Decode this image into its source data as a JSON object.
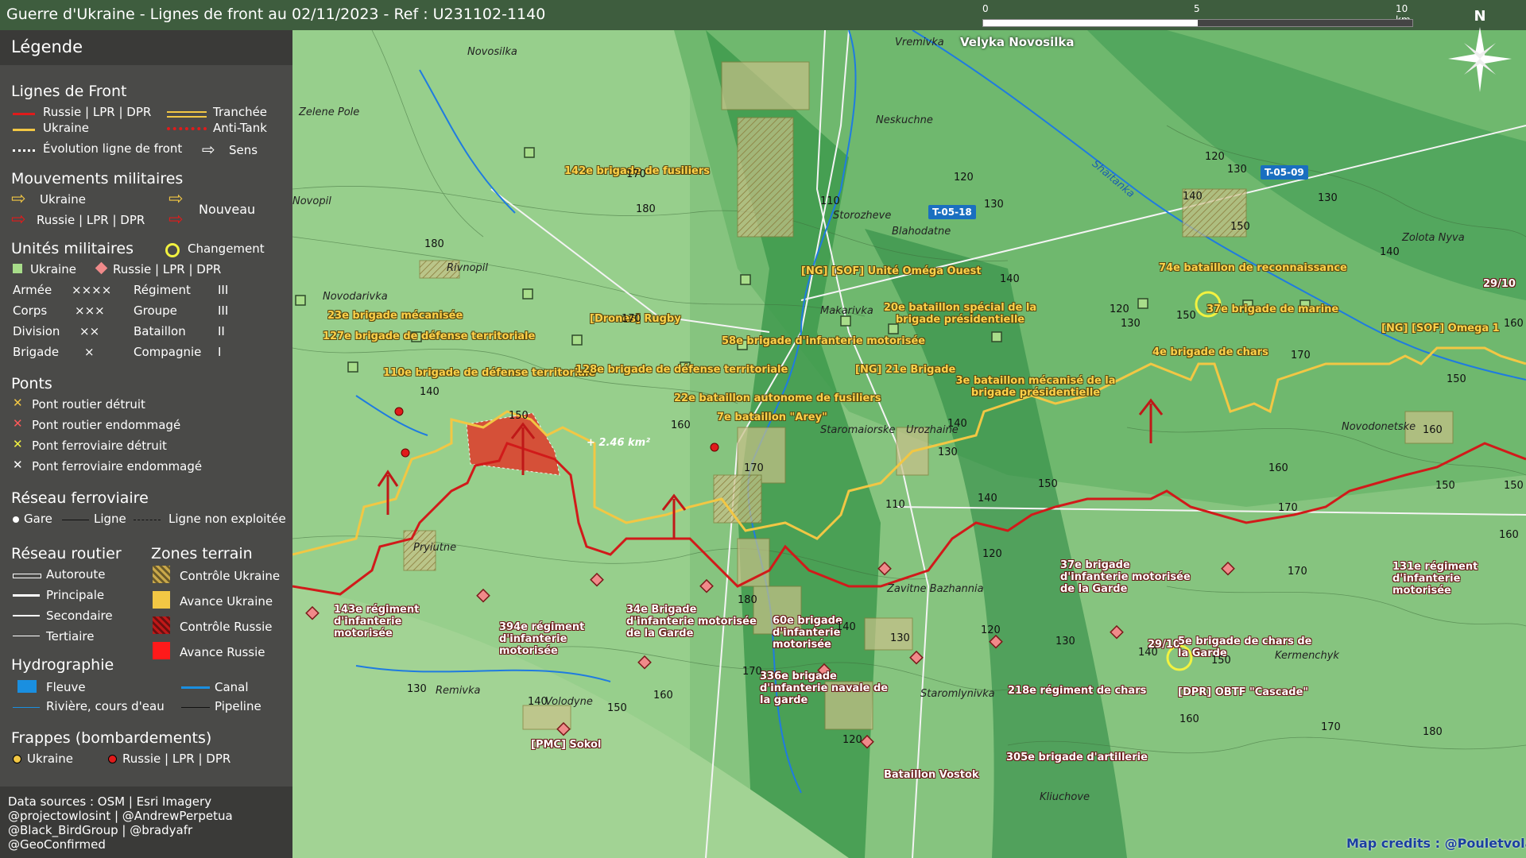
{
  "title": "Guerre d'Ukraine - Lignes de front au 02/11/2023 - Ref : U231102-1140",
  "scale": {
    "l0": "0",
    "l5": "5",
    "l10": "10 km"
  },
  "north": "N",
  "legend": {
    "header": "Légende",
    "front_title": "Lignes de Front",
    "front_ru": "Russie | LPR | DPR",
    "front_ua": "Ukraine",
    "front_evo": "Évolution ligne de front",
    "front_trench": "Tranchée",
    "front_antitank": "Anti-Tank",
    "front_dir": "Sens",
    "mov_title": "Mouvements militaires",
    "mov_ua": "Ukraine",
    "mov_ru": "Russie | LPR | DPR",
    "mov_new": "Nouveau",
    "units_title": "Unités militaires",
    "units_change": "Changement",
    "units_ua": "Ukraine",
    "units_ru": "Russie | LPR | DPR",
    "echelons": [
      {
        "name": "Armée",
        "sym": "××××",
        "name2": "Régiment",
        "sym2": "III"
      },
      {
        "name": "Corps",
        "sym": "×××",
        "name2": "Groupe",
        "sym2": "III"
      },
      {
        "name": "Division",
        "sym": "××",
        "name2": "Bataillon",
        "sym2": "II"
      },
      {
        "name": "Brigade",
        "sym": "×",
        "name2": "Compagnie",
        "sym2": "I"
      }
    ],
    "bridges_title": "Ponts",
    "bridges": [
      "Pont routier détruit",
      "Pont routier endommagé",
      "Pont ferroviaire détruit",
      "Pont ferroviaire endommagé"
    ],
    "rail_title": "Réseau ferroviaire",
    "rail_station": "Gare",
    "rail_line": "Ligne",
    "rail_unused": "Ligne non exploitée",
    "road_title": "Réseau routier",
    "roads": [
      "Autoroute",
      "Principale",
      "Secondaire",
      "Tertiaire"
    ],
    "zones_title": "Zones terrain",
    "zones": [
      "Contrôle Ukraine",
      "Avance Ukraine",
      "Contrôle Russie",
      "Avance Russie"
    ],
    "hydro_title": "Hydrographie",
    "hydro_fleuve": "Fleuve",
    "hydro_canal": "Canal",
    "hydro_river": "Rivière, cours d'eau",
    "hydro_pipe": "Pipeline",
    "strikes_title": "Frappes (bombardements)",
    "strikes_ua": "Ukraine",
    "strikes_ru": "Russie | LPR | DPR",
    "sources": [
      "Data sources : OSM | Esri Imagery",
      "@projectowlosint | @AndrewPerpetua",
      "@Black_BirdGroup | @bradyafr",
      "@GeoConfirmed"
    ],
    "colors": {
      "ua": "#f2c744",
      "ru": "#e01b1b",
      "panel": "#4a4a48"
    }
  },
  "map": {
    "towns": {
      "novosilka": "Novosilka",
      "zelene_pole": "Zelene Pole",
      "novopil": "Novopil",
      "rivnopil": "Rivnopil",
      "novodarivka": "Novodarivka",
      "pryiutne": "Pryiutne",
      "remivka": "Remivka",
      "volodyne": "Volodyne",
      "vremivka": "Vremivka",
      "velyka_novosilka": "Velyka Novosilka",
      "neskuchne": "Neskuchne",
      "storozheve": "Storozheve",
      "blahodatne": "Blahodatne",
      "makarivka": "Makarivka",
      "staromaiorske": "Staromaiorske",
      "urozhaine": "Urozhaine",
      "zavitne": "Zavitne Bazhannia",
      "staromlynivka": "Staromlynivka",
      "kliuchove": "Kliuchove",
      "novodonetske": "Novodonetske",
      "kermenchyk": "Kermenchyk",
      "zolota_nyva": "Zolota Nyva",
      "shaitanka": "Shaitanka"
    },
    "roads": {
      "t0518": "T-05-18",
      "t0509": "T-05-09"
    },
    "ua_units": {
      "u142": "142e brigade de fusiliers",
      "u23": "23e brigade mécanisée",
      "u127": "127e brigade de défense territoriale",
      "u110": "110e brigade de défense territoriale",
      "drones": "[Drones] Rugby",
      "u128": "128e brigade de défense territoriale",
      "u58": "58e brigade d'infanterie motorisée",
      "omega_ouest": "[NG] [SOF] Unité Oméga Ouest",
      "u20": "20e bataillon spécial de la brigade présidentielle",
      "ng21": "[NG] 21e Brigade",
      "u22": "22e bataillon autonome de fusiliers",
      "arey": "7e bataillon \"Arey\"",
      "u3": "3e bataillon mécanisé de la brigade présidentielle",
      "u74": "74e bataillon de reconnaissance",
      "u37m": "37e brigade de marine",
      "u4": "4e brigade de chars",
      "omega1": "[NG] [SOF] Omega 1"
    },
    "ru_units": {
      "r143": "143e régiment d'infanterie motorisée",
      "r394": "394e régiment d'infanterie motorisée",
      "r34": "34e Brigade d'infanterie motorisée de la Garde",
      "r60": "60e brigade d'infanterie motorisée",
      "r336": "336e brigade d'infanterie navale de la garde",
      "sokol": "[PMC] Sokol",
      "r37": "37e brigade d'infanterie motorisée de la Garde",
      "r5": "5e brigade de chars de la Garde",
      "r218": "218e régiment de chars",
      "cascade": "[DPR] OBTF \"Cascade\"",
      "r131": "131e régiment d'infanterie motorisée",
      "vostok": "Bataillon Vostok",
      "r305": "305e brigade d'artillerie"
    },
    "dates": {
      "d1": "29/10",
      "d2": "29/10"
    },
    "advance": "+ 2.46 km²",
    "elevations": [
      "170",
      "180",
      "180",
      "140",
      "150",
      "160",
      "170",
      "170",
      "140",
      "130",
      "120",
      "110",
      "130",
      "120",
      "130",
      "140",
      "150",
      "140",
      "160",
      "170",
      "150",
      "150",
      "160",
      "120",
      "130",
      "140",
      "150",
      "140",
      "120",
      "130",
      "140",
      "150",
      "160",
      "170",
      "150",
      "160",
      "170",
      "180",
      "130",
      "140",
      "150",
      "160",
      "170",
      "120",
      "130",
      "110",
      "140",
      "180",
      "120",
      "160",
      "170",
      "150",
      "130"
    ],
    "credit": "Map credits : @Pouletvolant3"
  }
}
